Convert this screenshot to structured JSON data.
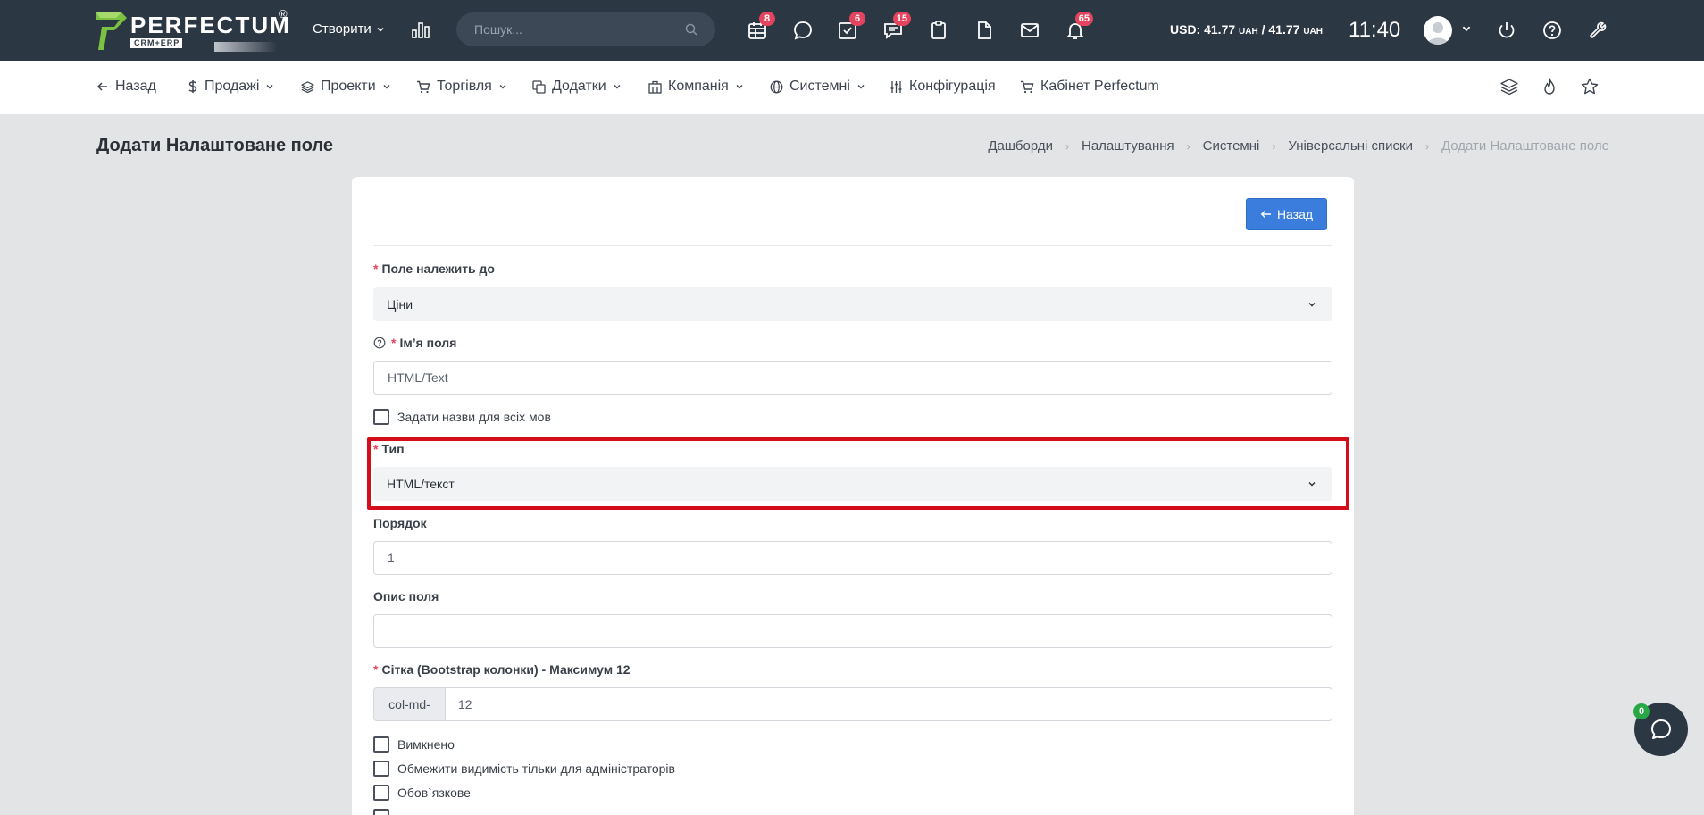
{
  "topbar": {
    "logo_word": "PERFECTUM",
    "logo_reg": "®",
    "logo_sub": "CRM+ERP",
    "create_label": "Створити",
    "search_placeholder": "Пошук...",
    "badges": {
      "calendar": "8",
      "tasks": "6",
      "chats": "15",
      "notifications": "65"
    },
    "currency_prefix": "USD: 41.77",
    "currency_unit1": "UAH",
    "currency_mid": " / 41.77",
    "currency_unit2": "UAH",
    "time": "11:40"
  },
  "nav": {
    "back": "Назад",
    "sales": "Продажі",
    "projects": "Проекти",
    "trade": "Торгівля",
    "addons": "Додатки",
    "company": "Компанія",
    "system": "Системні",
    "config": "Конфігурація",
    "cabinet": "Кабінет Perfectum"
  },
  "page": {
    "title": "Додати Налаштоване поле",
    "breadcrumb": [
      "Дашборди",
      "Налаштування",
      "Системні",
      "Універсальні списки",
      "Додати Налаштоване поле"
    ]
  },
  "form": {
    "back_button": "Назад",
    "belongs_label": "Поле належить до",
    "belongs_value": "Ціни",
    "name_label": "Ім’я поля",
    "name_value": "HTML/Text",
    "all_langs_label": "Задати назви для всіх мов",
    "type_label": "Тип",
    "type_value": "HTML/текст",
    "order_label": "Порядок",
    "order_value": "1",
    "description_label": "Опис поля",
    "description_value": "",
    "grid_label": "Сітка (Bootstrap колонки) - Максимум 12",
    "grid_addon": "col-md-",
    "grid_value": "12",
    "disabled_label": "Вимкнено",
    "admin_only_label": "Обмежити видимість тільки для адміністраторів",
    "required_label": "Обов`язкове",
    "required_star": "*"
  },
  "chat": {
    "badge": "0"
  },
  "colors": {
    "topbar": "#2c3744",
    "accent": "#3b7ddd",
    "badge": "#e5445f",
    "highlight": "#d40d1a"
  }
}
